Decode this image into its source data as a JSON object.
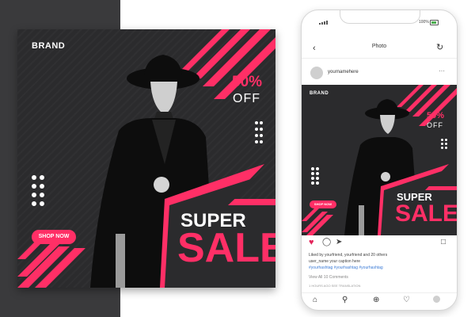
{
  "post": {
    "brand": "BRAND",
    "discount_percent": "50%",
    "discount_word": "OFF",
    "headline_top": "SUPER",
    "headline_bottom": "SALE",
    "cta_label": "SHOP NOW"
  },
  "phone": {
    "battery_text": "100%",
    "header": {
      "title": "Photo"
    },
    "account": {
      "username": "yournamehere"
    },
    "caption": {
      "liked_by": "Liked by yourfriend, yourfriend and 20 others",
      "user_caption": "user_name  your caption here",
      "hashtags": "#yourhashtag #yourhashtag #yourhashtag",
      "view_comments": "View All 10 Comments",
      "footer": "1 HOURS AGO     SEE TRANSLATION"
    }
  },
  "colors": {
    "accent": "#ff2f66",
    "dark": "#2b2b2d",
    "sidebar": "#3a3a3c",
    "hashtag": "#3b7bd6"
  },
  "icons": {
    "back": "chevron-left-icon",
    "refresh": "refresh-icon",
    "more": "more-dots-icon",
    "like": "heart-icon",
    "comment": "comment-icon",
    "share": "send-icon",
    "save": "bookmark-icon",
    "home": "home-icon",
    "search": "search-icon",
    "add": "add-icon",
    "activity": "heart-icon"
  }
}
